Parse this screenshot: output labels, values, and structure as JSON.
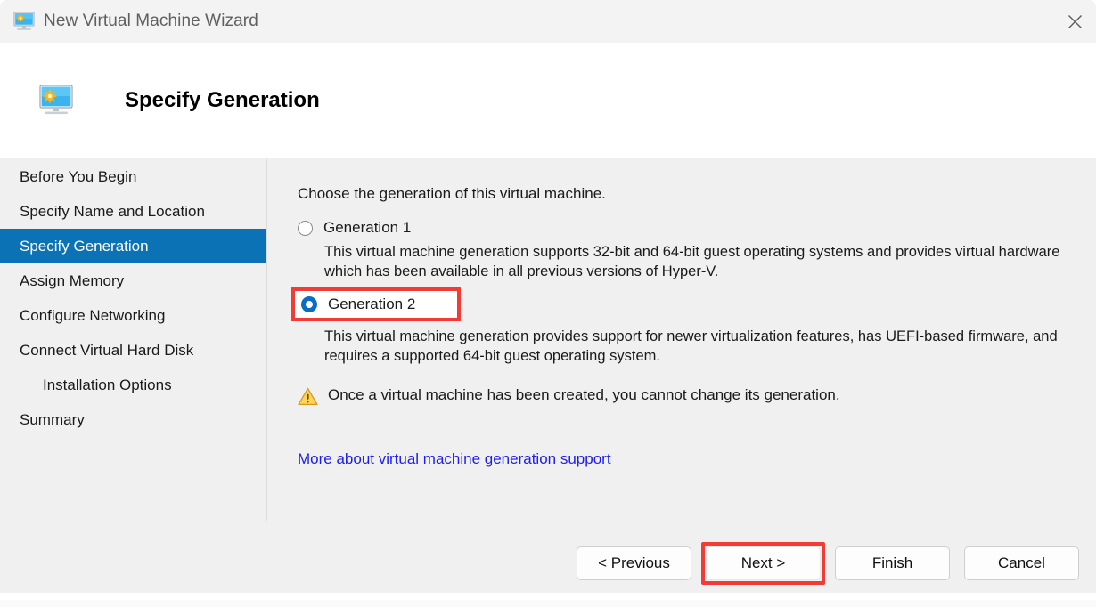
{
  "window": {
    "title": "New Virtual Machine Wizard",
    "title_icon": "virtual-machine-monitor-icon",
    "close_icon": "close-icon"
  },
  "header": {
    "title": "Specify Generation",
    "icon": "virtual-machine-monitor-icon"
  },
  "sidebar": {
    "items": [
      {
        "label": "Before You Begin",
        "active": false,
        "indent": false
      },
      {
        "label": "Specify Name and Location",
        "active": false,
        "indent": false
      },
      {
        "label": "Specify Generation",
        "active": true,
        "indent": false
      },
      {
        "label": "Assign Memory",
        "active": false,
        "indent": false
      },
      {
        "label": "Configure Networking",
        "active": false,
        "indent": false
      },
      {
        "label": "Connect Virtual Hard Disk",
        "active": false,
        "indent": false
      },
      {
        "label": "Installation Options",
        "active": false,
        "indent": true
      },
      {
        "label": "Summary",
        "active": false,
        "indent": false
      }
    ]
  },
  "content": {
    "intro": "Choose the generation of this virtual machine.",
    "options": [
      {
        "label": "Generation 1",
        "selected": false,
        "highlighted": false,
        "description": "This virtual machine generation supports 32-bit and 64-bit guest operating systems and provides virtual hardware which has been available in all previous versions of Hyper-V."
      },
      {
        "label": "Generation 2",
        "selected": true,
        "highlighted": true,
        "description": "This virtual machine generation provides support for newer virtualization features, has UEFI-based firmware, and requires a supported 64-bit guest operating system."
      }
    ],
    "warning": {
      "icon": "warning-triangle-icon",
      "text": "Once a virtual machine has been created, you cannot change its generation."
    },
    "link": "More about virtual machine generation support"
  },
  "footer": {
    "buttons": [
      {
        "label": "< Previous",
        "highlighted": false
      },
      {
        "label": "Next >",
        "highlighted": true
      },
      {
        "label": "Finish",
        "highlighted": false
      },
      {
        "label": "Cancel",
        "highlighted": false
      }
    ]
  },
  "colors": {
    "accent": "#0b72b5",
    "annotation": "#f23b35",
    "link": "#1d1df0",
    "warning": "#f2b01e",
    "body_bg": "#f0f0f0"
  }
}
